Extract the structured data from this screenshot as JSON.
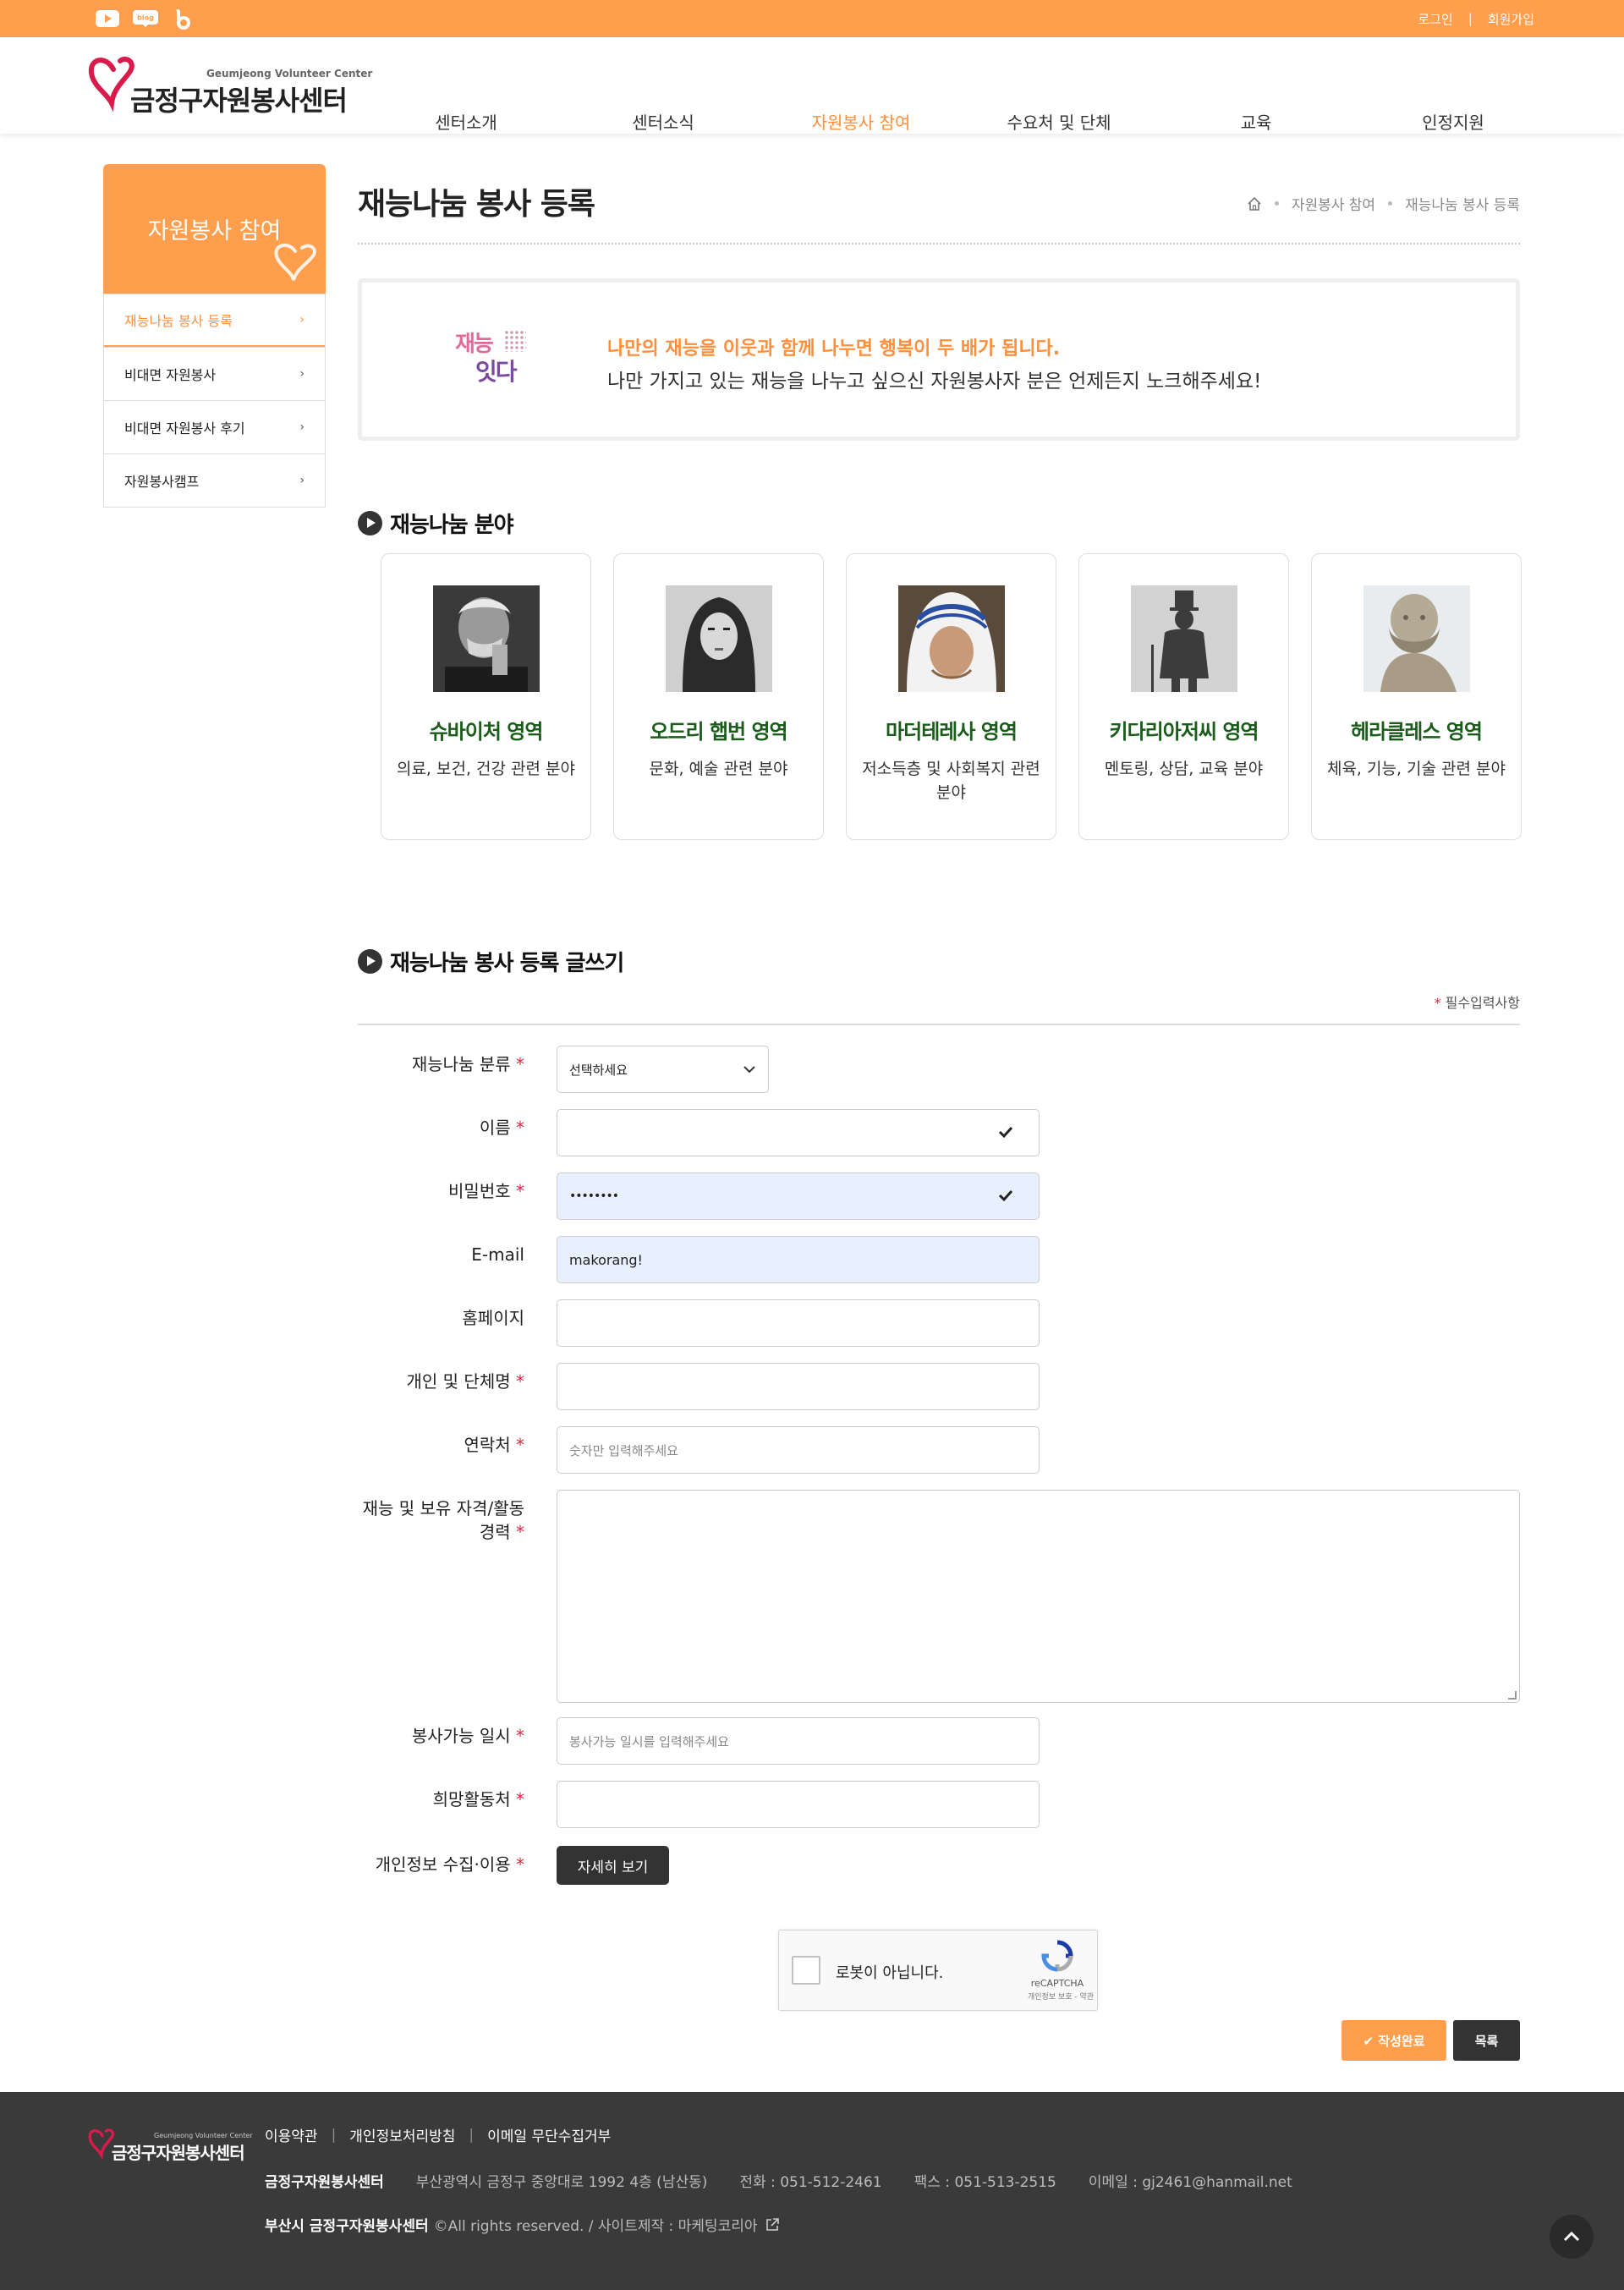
{
  "topbar": {
    "login": "로그인",
    "join": "회원가입",
    "separator": "|",
    "sns": [
      "youtube-icon",
      "blog-icon",
      "band-icon"
    ],
    "blog_text": "blog"
  },
  "header": {
    "logo_sub": "Geumjeong Volunteer Center",
    "logo_main": "금정구자원봉사센터",
    "nav": [
      "센터소개",
      "센터소식",
      "자원봉사 참여",
      "수요처 및 단체",
      "교육",
      "인정지원"
    ]
  },
  "sidebar": {
    "title": "자원봉사 참여",
    "items": [
      {
        "label": "재능나눔 봉사 등록",
        "active": true
      },
      {
        "label": "비대면 자원봉사"
      },
      {
        "label": "비대면 자원봉사 후기"
      },
      {
        "label": "자원봉사캠프"
      }
    ]
  },
  "page": {
    "title": "재능나눔 봉사 등록",
    "breadcrumb": [
      "자원봉사 참여",
      "재능나눔 봉사 등록"
    ]
  },
  "intro": {
    "logo_top": "재능",
    "logo_bottom": "잇다",
    "line1": "나만의 재능을 이웃과 함께 나누면 행복이 두 배가 됩니다.",
    "line2": "나만 가지고 있는 재능을 나누고 싶으신 자원봉사자 분은 언제든지 노크해주세요!"
  },
  "section1": {
    "title": "재능나눔 분야"
  },
  "categories": [
    {
      "name": "슈바이처 영역",
      "desc": "의료, 보건, 건강 관련 분야"
    },
    {
      "name": "오드리 햅번 영역",
      "desc": "문화, 예술 관련 분야"
    },
    {
      "name": "마더테레사 영역",
      "desc": "저소득층 및 사회복지 관련 분야"
    },
    {
      "name": "키다리아저씨 영역",
      "desc": "멘토링, 상담, 교육 분야"
    },
    {
      "name": "헤라클레스 영역",
      "desc": "체육, 기능, 기술 관련 분야"
    }
  ],
  "section2": {
    "title": "재능나눔 봉사 등록 글쓰기"
  },
  "form": {
    "required_note": "필수입력사항",
    "required_mark": "*",
    "category": {
      "label": "재능나눔 분류",
      "value": "선택하세요"
    },
    "name": {
      "label": "이름",
      "value": ""
    },
    "password": {
      "label": "비밀번호",
      "value": "••••••••"
    },
    "email": {
      "label": "E-mail",
      "value": "makorang!"
    },
    "homepage": {
      "label": "홈페이지",
      "value": ""
    },
    "org": {
      "label": "개인 및 단체명",
      "value": ""
    },
    "contact": {
      "label": "연락처",
      "placeholder": "숫자만 입력해주세요"
    },
    "career": {
      "label": "재능 및 보유 자격/활동 경력"
    },
    "available": {
      "label": "봉사가능 일시",
      "placeholder": "봉사가능 일시를 입력해주세요"
    },
    "place": {
      "label": "희망활동처",
      "value": ""
    },
    "privacy": {
      "label": "개인정보 수집·이용",
      "button": "자세히 보기"
    }
  },
  "captcha": {
    "text": "로봇이 아닙니다.",
    "brand": "reCAPTCHA",
    "terms": "개인정보 보호 - 약관"
  },
  "buttons": {
    "submit": "✔ 작성완료",
    "list": "목록"
  },
  "footer": {
    "logo_sub": "Geumjeong Volunteer Center",
    "logo_main": "금정구자원봉사센터",
    "links": [
      "이용약관",
      "개인정보처리방침",
      "이메일 무단수집거부"
    ],
    "org": "금정구자원봉사센터",
    "address": "부산광역시 금정구 중앙대로 1992 4층 (남산동)",
    "phone": "전화 : 051-512-2461",
    "fax": "팩스 : 051-513-2515",
    "email": "이메일 : gj2461@hanmail.net",
    "copy_org": "부산시 금정구자원봉사센터",
    "copy_rest": "©All rights reserved. / 사이트제작 : 마케팅코리아"
  },
  "colors": {
    "accent": "#ff9e4d",
    "accent_text": "#ff8f3c",
    "dark": "#333333",
    "footer": "#3a3a3a",
    "category_name": "#1a5c1a"
  }
}
